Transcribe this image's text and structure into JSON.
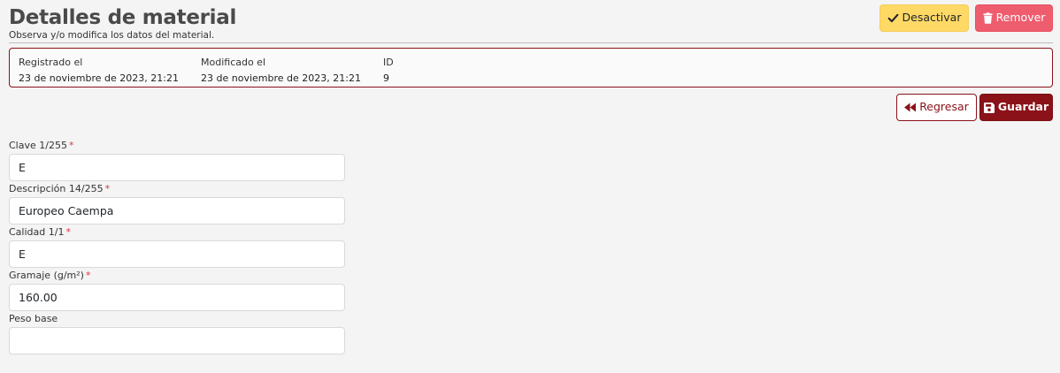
{
  "header": {
    "title": "Detalles de material",
    "subtitle": "Observa y/o modifica los datos del material."
  },
  "actions": {
    "deactivate_label": "Desactivar",
    "remove_label": "Remover",
    "back_label": "Regresar",
    "save_label": "Guardar"
  },
  "meta": {
    "registered_label": "Registrado el",
    "registered_value": "23 de noviembre de 2023, 21:21",
    "modified_label": "Modificado el",
    "modified_value": "23 de noviembre de 2023, 21:21",
    "id_label": "ID",
    "id_value": "9"
  },
  "form": {
    "required_mark": "*",
    "fields": [
      {
        "label": "Clave 1/255",
        "value": "E",
        "required": true
      },
      {
        "label": "Descripción 14/255",
        "value": "Europeo Caempa",
        "required": true
      },
      {
        "label": "Calidad 1/1",
        "value": "E",
        "required": true
      },
      {
        "label": "Gramaje (g/m²)",
        "value": "160.00",
        "required": true
      },
      {
        "label": "Peso base",
        "value": "",
        "required": false
      }
    ]
  },
  "icons": {
    "deactivate": "check-icon",
    "remove": "trash-icon",
    "back": "rewind-icon",
    "save": "floppy-disk-icon"
  },
  "colors": {
    "brand": "#8b1219",
    "warning": "#ffd966",
    "danger": "#ee5d6e",
    "required": "#dc3545"
  }
}
